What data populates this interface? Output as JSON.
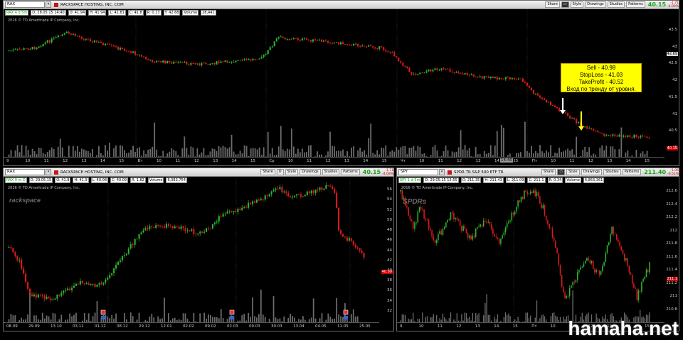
{
  "toolbar_buttons": {
    "share": "Share",
    "style": "Style",
    "drawings": "Drawings",
    "studies": "Studies",
    "patterns": "Patterns",
    "period_d": "D"
  },
  "top": {
    "symbol": "RAX",
    "company": "RACKSPACE HOSTING, INC. COM",
    "price": "40.15",
    "change": "-1.71",
    "change_pct": "-4.09%",
    "info": {
      "tag": "RAX 4 d 5m",
      "o": "D: 28.05.15 14:40",
      "open": "O: 41.94",
      "high": "H: 41.94",
      "low": "L: 41.81",
      "close": "C: 41.8",
      "r": "R: 0.13",
      "y": "Y: 42.68",
      "vol": "Volume",
      "volv": "28,441"
    },
    "copyright": "2016 © TD Ameritrade IP Company, Inc.",
    "yticks": [
      "43.5",
      "43",
      "42.5",
      "42",
      "41.5",
      "41",
      "40.5",
      "40"
    ],
    "price_tags": {
      "cur": "42.69",
      "last": "40.15"
    },
    "xticks": [
      "9",
      "10",
      "11",
      "12",
      "13",
      "14",
      "15",
      "Вт",
      "10",
      "11",
      "12",
      "13",
      "14",
      "15",
      "Ср",
      "10",
      "11",
      "12",
      "13",
      "14",
      "15",
      "Чт",
      "10",
      "11",
      "12",
      "13",
      "14",
      "15",
      "Пт",
      "10",
      "11",
      "12",
      "13",
      "14",
      "15"
    ],
    "x_highlight": "14:40",
    "annotation": [
      "Sell - 40.98",
      "StopLoss - 41.03",
      "TakeProfit - 40.52",
      "Вход по тренду от уровня."
    ],
    "colors": {
      "up": "#2fb52f",
      "down": "#e01b1b",
      "white_arrow": "#ffffff",
      "yellow_arrow": "#ffff00"
    }
  },
  "left": {
    "symbol": "RAX",
    "company": "RACKSPACE HOSTING, INC. COM",
    "price": "40.15",
    "change": "-1.71",
    "change_pct": "-4.09%",
    "info": {
      "tag": "RAX 9 m D",
      "o": "D: 29.05.15",
      "open": "O: 41.9",
      "high": "H: 41.9",
      "low": "L: 40.08",
      "close": "C: 40.09",
      "r": "R: 1.82",
      "vol": "Volume",
      "volv": "6,083,754"
    },
    "copyright": "2016 © TD Ameritrade IP Company, Inc.",
    "logo": "rackspace",
    "yticks": [
      "56",
      "54",
      "52",
      "50",
      "48",
      "46",
      "44",
      "42",
      "40",
      "38",
      "36",
      "34",
      "32"
    ],
    "price_tag": "40.09",
    "xticks": [
      "08.09",
      "29.09",
      "13.10",
      "03.11",
      "01.12",
      "08.12",
      "29.12",
      "12.01",
      "02.02",
      "09.02",
      "02.03",
      "09.03",
      "30.03",
      "13.04",
      "04.05",
      "11.05",
      "25.05"
    ]
  },
  "right": {
    "symbol": "SPY",
    "company": "SPDR TR S&P 500 ETF TR",
    "price": "211.40",
    "change": "-1.06",
    "change_pct": "-0.51%",
    "info": {
      "tag": "SPY 1 d 5m",
      "o": "D: 29.05.15 15:55",
      "open": "O: 211.35",
      "high": "H: 211.43",
      "low": "L: 211.09",
      "close": "C: 211.1",
      "r": "R: 0.34",
      "vol": "Volume",
      "volv": "6,863,361"
    },
    "copyright": "2016 © TD Ameritrade IP Company, Inc.",
    "logo": "SPDRs",
    "yticks": [
      "212.6",
      "212.4",
      "212.2",
      "212",
      "211.8",
      "211.6",
      "211.4",
      "211.2",
      "211",
      "210.8"
    ],
    "price_tag": "211.1",
    "xticks": [
      "9",
      "10",
      "11",
      "12",
      "13",
      "14",
      "15",
      "Пт",
      "10",
      "11",
      "12",
      "13",
      "14",
      "15"
    ]
  },
  "watermark": "hamaha.net"
}
